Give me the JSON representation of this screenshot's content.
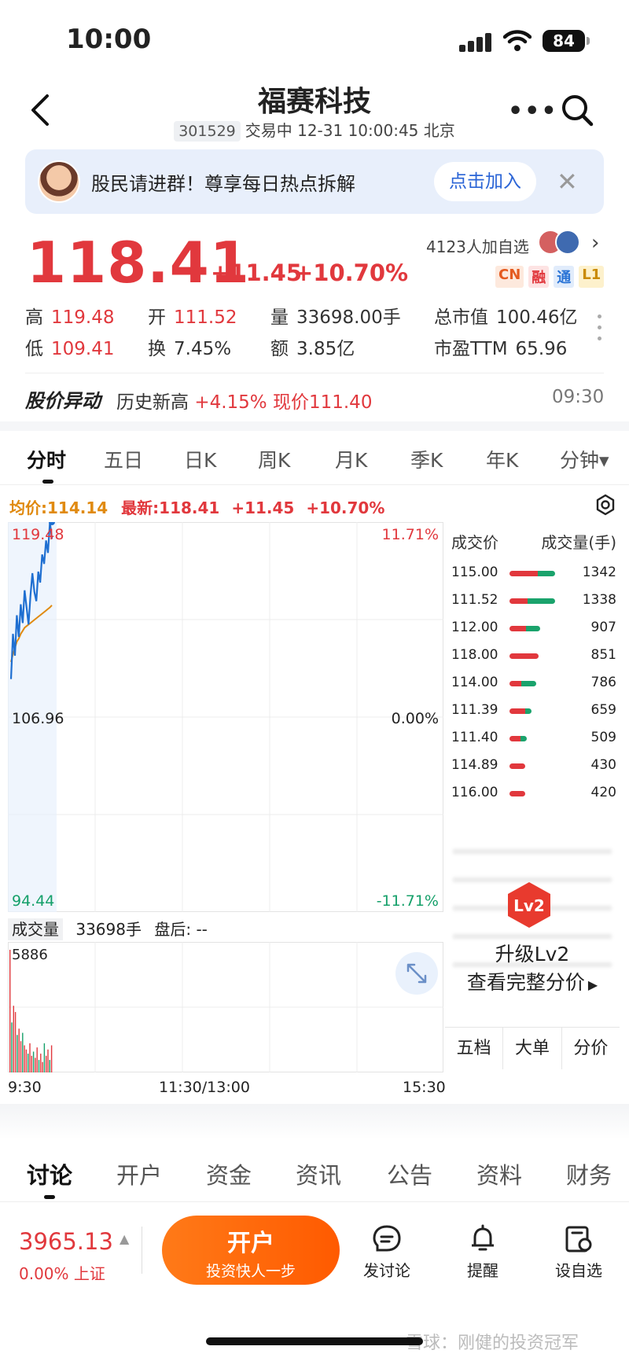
{
  "status": {
    "time": "10:00",
    "battery": "84"
  },
  "header": {
    "title": "福赛科技",
    "code": "301529",
    "status_line": "交易中 12-31 10:00:45 北京",
    "more_label": "•••"
  },
  "banner": {
    "text": "股民请进群！尊享每日热点拆解",
    "button": "点击加入",
    "close": "✕"
  },
  "quote": {
    "price": "118.41",
    "change": "+11.45",
    "change_pct": "+10.70%",
    "followers": "4123人加自选",
    "badges": [
      "CN",
      "融",
      "通",
      "L1"
    ],
    "stats": {
      "high_label": "高",
      "high": "119.48",
      "open_label": "开",
      "open": "111.52",
      "volume_label": "量",
      "volume": "33698.00手",
      "mcap_label": "总市值",
      "mcap": "100.46亿",
      "low_label": "低",
      "low": "109.41",
      "turnover_label": "换",
      "turnover": "7.45%",
      "amount_label": "额",
      "amount": "3.85亿",
      "pe_label": "市盈TTM",
      "pe": "65.96"
    }
  },
  "movement": {
    "title": "股价异动",
    "text_a": "历史新高",
    "text_b": "+4.15%",
    "text_c": "现价111.40",
    "time": "09:30"
  },
  "chart_tabs": [
    "分时",
    "五日",
    "日K",
    "周K",
    "月K",
    "季K",
    "年K",
    "分钟▾"
  ],
  "chart_header": {
    "avg": "均价:114.14",
    "latest": "最新:118.41",
    "chg": "+11.45",
    "pct": "+10.70%"
  },
  "chart_data": {
    "type": "line",
    "y_left_ticks": [
      "119.48",
      "106.96",
      "94.44"
    ],
    "y_right_ticks": [
      "11.71%",
      "0.00%",
      "-11.71%"
    ],
    "x_ticks": [
      "9:30",
      "11:30/13:00",
      "15:30"
    ],
    "ylim": [
      94.44,
      119.48
    ],
    "series": [
      {
        "values": [
          109.4,
          112.3,
          110.9,
          113.5,
          112.1,
          114.2,
          113.0,
          115.1,
          114.0,
          112.9,
          114.8,
          116.2,
          115.0,
          114.4,
          116.3,
          115.6,
          117.4,
          116.8,
          118.3,
          117.5,
          119.48,
          118.41
        ],
        "color": "#1f6fd1"
      },
      {
        "values": [
          110.5,
          111.0,
          111.4,
          111.8,
          112.0,
          112.3,
          112.5,
          112.7,
          112.8,
          112.9,
          113.0,
          113.1,
          113.2,
          113.3,
          113.4,
          113.5,
          113.6,
          113.7,
          113.8,
          113.9,
          114.0,
          114.14
        ],
        "color": "#e08a10"
      }
    ],
    "volume": {
      "label": "成交量",
      "total": "33698手",
      "after_hours": "盘后: --",
      "max_label": "5886",
      "values": [
        5886,
        2400,
        3200,
        2900,
        1800,
        2100,
        1500,
        1900,
        1300,
        1100,
        900,
        1400,
        800,
        1000,
        700,
        1200,
        600,
        900,
        500,
        1400,
        800,
        1100,
        600,
        1300
      ]
    }
  },
  "trades": {
    "head_price": "成交价",
    "head_qty": "成交量(手)",
    "rows": [
      {
        "price": "115.00",
        "qty": "1342",
        "red": 0.62,
        "green": 0.38
      },
      {
        "price": "111.52",
        "qty": "1338",
        "red": 0.4,
        "green": 0.6
      },
      {
        "price": "112.00",
        "qty": "907",
        "red": 0.55,
        "green": 0.45
      },
      {
        "price": "118.00",
        "qty": "851",
        "red": 1.0,
        "green": 0.0
      },
      {
        "price": "114.00",
        "qty": "786",
        "red": 0.45,
        "green": 0.55
      },
      {
        "price": "111.39",
        "qty": "659",
        "red": 0.7,
        "green": 0.3
      },
      {
        "price": "111.40",
        "qty": "509",
        "red": 0.65,
        "green": 0.35
      },
      {
        "price": "114.89",
        "qty": "430",
        "red": 1.0,
        "green": 0.0
      },
      {
        "price": "116.00",
        "qty": "420",
        "red": 1.0,
        "green": 0.0
      }
    ],
    "lv2_badge": "Lv2",
    "lv2_title": "升级Lv2",
    "lv2_link": "查看完整分价",
    "sub_tabs": [
      "五档",
      "大单",
      "分价"
    ]
  },
  "bottom_tabs": [
    "讨论",
    "开户",
    "资金",
    "资讯",
    "公告",
    "资料",
    "财务"
  ],
  "footer": {
    "index_value": "3965.13",
    "index_sub": "0.00% 上证",
    "open_main": "开户",
    "open_sub": "投资快人一步",
    "discuss": "发讨论",
    "remind": "提醒",
    "watch": "设自选"
  },
  "watermark": "雪球：刚健的投资冠军",
  "colors": {
    "up": "#e1383d",
    "down": "#15a06a",
    "accent": "#ff6a00",
    "line": "#1f6fd1",
    "avg": "#e08a10"
  }
}
